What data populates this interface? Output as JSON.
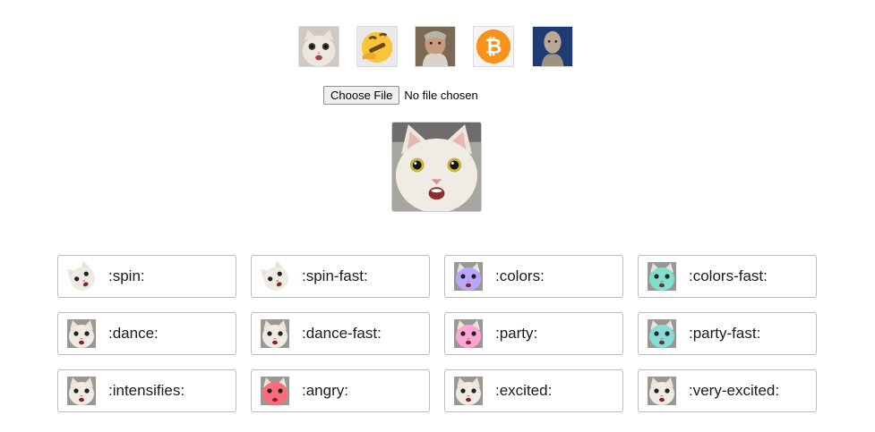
{
  "presets": [
    {
      "name": "cat",
      "icon": "cat-face-icon"
    },
    {
      "name": "thinking",
      "icon": "thinking-emoji-icon"
    },
    {
      "name": "wizard",
      "icon": "old-wizard-icon"
    },
    {
      "name": "bitcoin",
      "icon": "bitcoin-icon"
    },
    {
      "name": "meme-man",
      "icon": "meme-man-icon"
    }
  ],
  "file_input": {
    "button_label": "Choose File",
    "status": "No file chosen"
  },
  "effects": [
    {
      "label": ":spin:",
      "tint": "none",
      "rotate": 1
    },
    {
      "label": ":spin-fast:",
      "tint": "none",
      "rotate": 1
    },
    {
      "label": ":colors:",
      "tint": "#b9a7ff",
      "rotate": 0
    },
    {
      "label": ":colors-fast:",
      "tint": "#7fe0d0",
      "rotate": 0
    },
    {
      "label": ":dance:",
      "tint": "none",
      "rotate": 0
    },
    {
      "label": ":dance-fast:",
      "tint": "none",
      "rotate": 0
    },
    {
      "label": ":party:",
      "tint": "#ffa6d8",
      "rotate": 0
    },
    {
      "label": ":party-fast:",
      "tint": "#86dcd6",
      "rotate": 0
    },
    {
      "label": ":intensifies:",
      "tint": "none",
      "rotate": 0
    },
    {
      "label": ":angry:",
      "tint": "#ff6b7a",
      "rotate": 0
    },
    {
      "label": ":excited:",
      "tint": "none",
      "rotate": 0
    },
    {
      "label": ":very-excited:",
      "tint": "none",
      "rotate": 0
    }
  ],
  "colors": {
    "bitcoin": "#f7931a",
    "thinking": "#f9c43a",
    "meme_bg": "#1f3b73",
    "tile_border": "#bdbdbd"
  }
}
